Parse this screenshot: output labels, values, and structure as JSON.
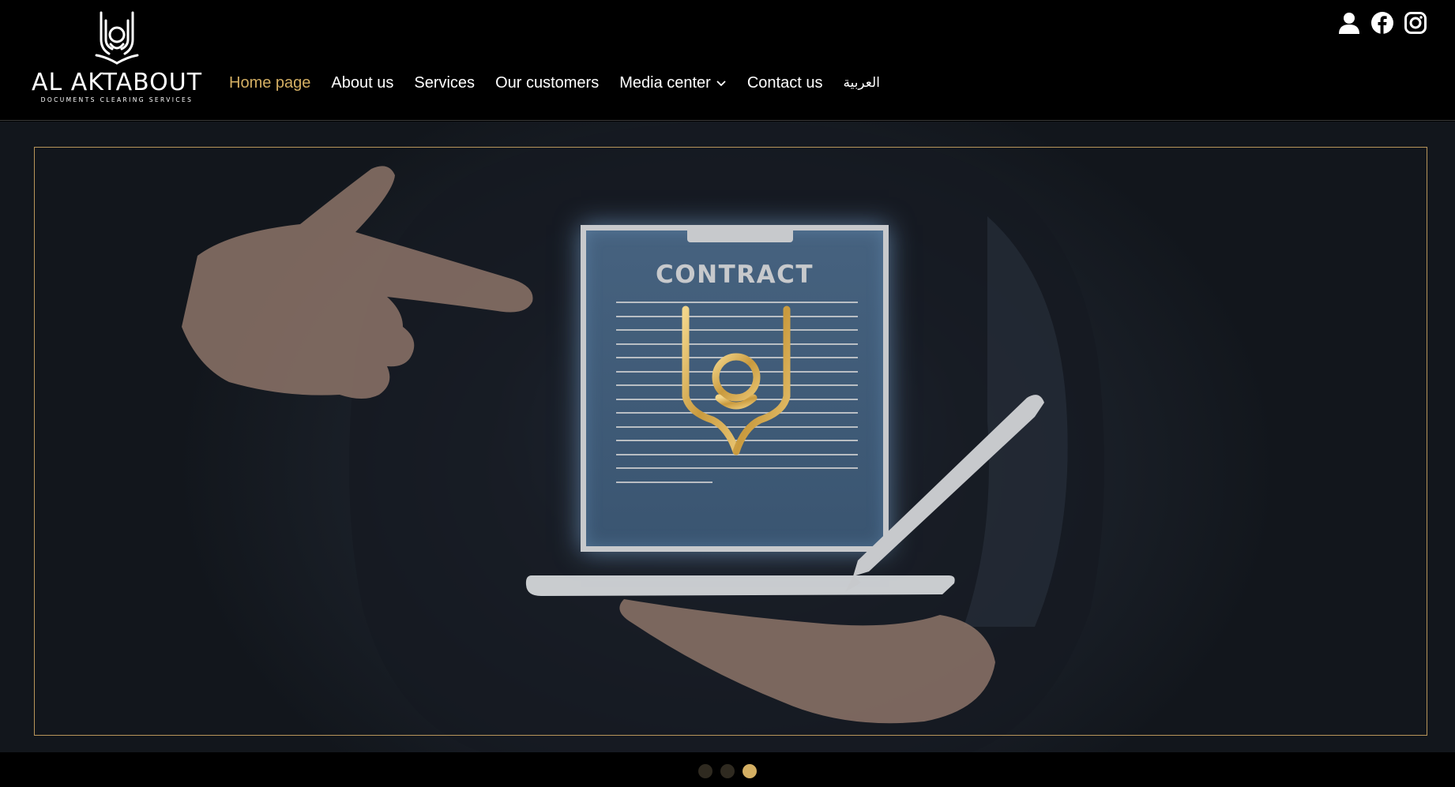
{
  "brand": {
    "name": "AL AKTABOUT",
    "tagline": "DOCUMENTS CLEARING SERVICES",
    "accent_color": "#d4af63"
  },
  "nav": {
    "items": [
      {
        "label": "Home page",
        "active": true
      },
      {
        "label": "About us",
        "active": false
      },
      {
        "label": "Services",
        "active": false
      },
      {
        "label": "Our customers",
        "active": false
      },
      {
        "label": "Media center",
        "active": false,
        "has_dropdown": true
      },
      {
        "label": "Contact us",
        "active": false
      },
      {
        "label": "العربية",
        "active": false
      }
    ]
  },
  "top_icons": [
    "user-icon",
    "facebook-icon",
    "instagram-icon"
  ],
  "hero": {
    "contract_title": "CONTRACT",
    "slides_total": 3,
    "active_slide": 3
  }
}
